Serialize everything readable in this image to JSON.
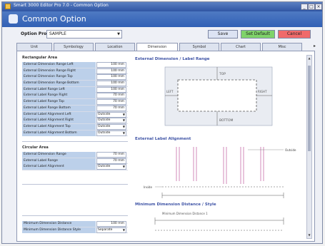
{
  "window": {
    "title": "Smart 3000 Editor Pro 7.0 - Common Option"
  },
  "header": {
    "title": "Common Option"
  },
  "profile": {
    "label": "Option Profile",
    "value": "SAMPLE"
  },
  "buttons": {
    "save": "Save",
    "set_default": "Set Default",
    "cancel": "Cancel"
  },
  "tabs": [
    "Unit",
    "Symbology",
    "Location",
    "Dimension",
    "Symbol",
    "Chart",
    "Misc"
  ],
  "active_tab": "Dimension",
  "rectangular": {
    "title": "Rectangular Area",
    "rows": [
      {
        "label": "External Dimension Range Left",
        "value": "100 mm"
      },
      {
        "label": "External Dimension Range Right",
        "value": "100 mm"
      },
      {
        "label": "External Dimension Range Top",
        "value": "100 mm"
      },
      {
        "label": "External Dimension Range Bottom",
        "value": "100 mm"
      },
      {
        "label": "External Label Range Left",
        "value": "100 mm"
      },
      {
        "label": "External Label Range Right",
        "value": "70 mm"
      },
      {
        "label": "External Label Range Top",
        "value": "70 mm"
      },
      {
        "label": "External Label Range Bottom",
        "value": "70 mm"
      },
      {
        "label": "External Label Alignment Left",
        "value": "Outside"
      },
      {
        "label": "External Label Alignment Right",
        "value": "Outside"
      },
      {
        "label": "External Label Alignment Top",
        "value": "Outside"
      },
      {
        "label": "External Label Alignment Bottom",
        "value": "Outside"
      }
    ]
  },
  "circular": {
    "title": "Circular Area",
    "rows": [
      {
        "label": "External Dimension Range",
        "value": "70 mm"
      },
      {
        "label": "External Label Range",
        "value": "70 mm"
      },
      {
        "label": "External Label Alignment",
        "value": "Outside"
      }
    ]
  },
  "minimum": {
    "rows": [
      {
        "label": "Minimum Dimension Distance",
        "value": "100 mm"
      },
      {
        "label": "Minimum Dimension Distance Style",
        "value": "Separate"
      }
    ]
  },
  "preview": {
    "section1": "External Dimension / Label Range",
    "section2": "External Label Alignment",
    "section3": "Minimum Dimension Distance / Style",
    "top": "TOP",
    "bottom": "BOTTOM",
    "left": "LEFT",
    "right": "RIGHT",
    "outside": "Outside",
    "inside": "Inside",
    "min_label": "Minimum Dimension Distance 1"
  },
  "colors": {
    "header": "#3a66b8",
    "row_label": "#bcd0ea",
    "save": "#dce3f3",
    "set_default": "#7fd36a",
    "cancel": "#f06a6a"
  }
}
